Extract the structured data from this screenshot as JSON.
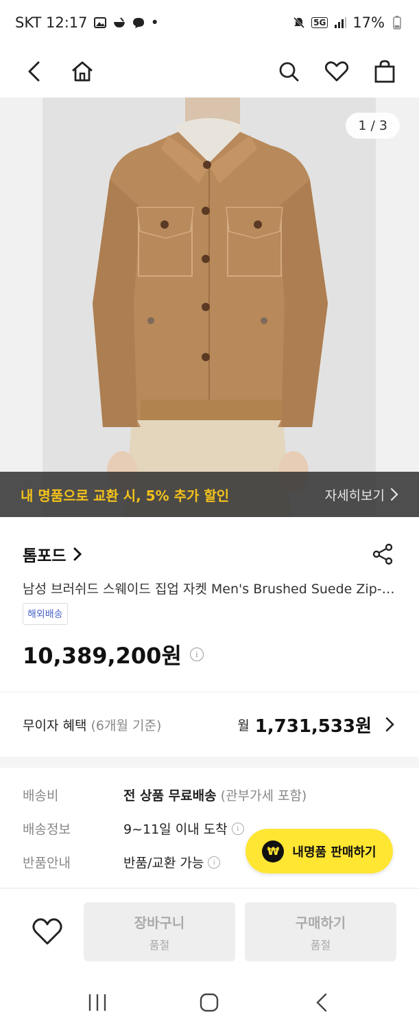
{
  "status_bar": {
    "carrier_time": "SKT 12:17",
    "dot": "•",
    "network": "5G",
    "battery": "17%"
  },
  "product": {
    "image_counter": "1 / 3",
    "promo_text": "내 명품으로 교환 시, 5% 추가 할인",
    "promo_more": "자세히보기",
    "brand": "톰포드",
    "name": "남성 브러쉬드 스웨이드 집업 자켓 Men's Brushed Suede Zip-Up Jacket",
    "badge": "해외배송",
    "price": "10,389,200원",
    "image_colors": {
      "jacket": "#b8895a",
      "sweater": "#e8e4dc",
      "pants": "#e3d6bd",
      "background": "#e2e2e2"
    }
  },
  "installment": {
    "label": "무이자 혜택",
    "sub": "(6개월 기준)",
    "month_prefix": "월",
    "amount": "1,731,533원"
  },
  "shipping": {
    "rows": [
      {
        "key": "배송비",
        "value_bold": "전 상품 무료배송",
        "value_muted": "(관부가세 포함)"
      },
      {
        "key": "배송정보",
        "value": "9~11일 이내 도착"
      },
      {
        "key": "반품안내",
        "value": "반품/교환 가능"
      }
    ]
  },
  "sell_button": {
    "icon_glyph": "₩",
    "label": "내명품 판매하기"
  },
  "action_bar": {
    "cart": {
      "label": "장바구니",
      "status": "품절"
    },
    "buy": {
      "label": "구매하기",
      "status": "품절"
    }
  },
  "colors": {
    "promo_accent": "#f4c21b",
    "sell_button": "#ffe633",
    "badge_text": "#4a63c7"
  }
}
